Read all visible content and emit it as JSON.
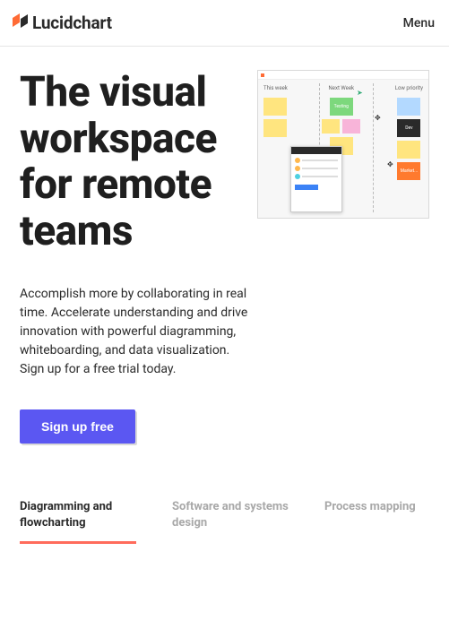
{
  "header": {
    "brand": "Lucidchart",
    "menu": "Menu"
  },
  "hero": {
    "title": "The visual workspace for remote teams",
    "subtitle": "Accomplish more by collaborating in real time. Accelerate under­standing and drive innovation with powerful diagramming, white­boarding, and data visualization. Sign up for a free trial today.",
    "cta": "Sign up free",
    "image_cols": [
      "This week",
      "Next Week",
      "Low priority"
    ],
    "sticky_green": "Testing",
    "sticky_black": "Dev",
    "sticky_orange": "Market..."
  },
  "tabs": [
    {
      "label": "Diagramming and flowcharting",
      "active": true
    },
    {
      "label": "Software and systems design",
      "active": false
    },
    {
      "label": "Process mapping",
      "active": false
    }
  ]
}
